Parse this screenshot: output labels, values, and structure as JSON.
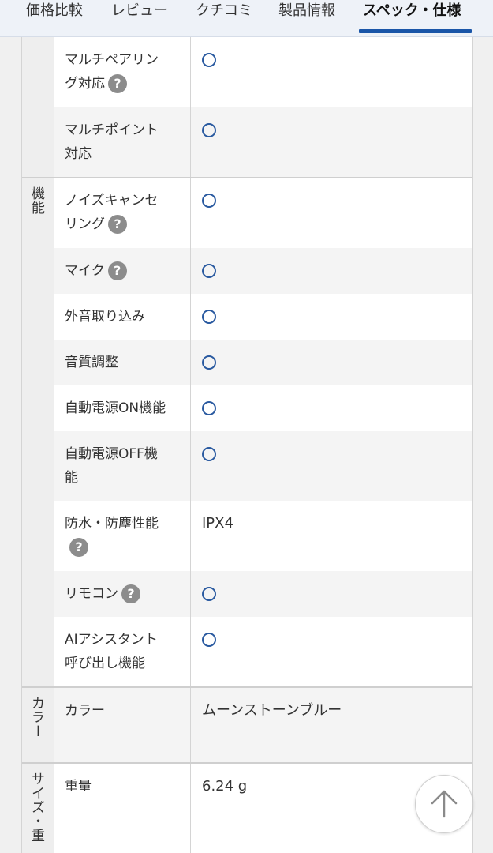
{
  "tabs": [
    {
      "label": "価格比較"
    },
    {
      "label": "レビュー"
    },
    {
      "label": "クチコミ"
    },
    {
      "label": "製品情報"
    },
    {
      "label": "スペック・仕様"
    }
  ],
  "sections": {
    "kinou": "機能",
    "color": "カラー",
    "size": "サイズ・重"
  },
  "rows": {
    "multipairing_1": "マルチペアリン",
    "multipairing_2": "グ対応",
    "multipoint_1": "マルチポイント",
    "multipoint_2": "対応",
    "nc_1": "ノイズキャンセ",
    "nc_2": "リング",
    "mic": "マイク",
    "ambient": "外音取り込み",
    "eq": "音質調整",
    "auto_on": "自動電源ON機能",
    "auto_off_1": "自動電源OFF機",
    "auto_off_2": "能",
    "waterproof": "防水・防塵性能",
    "waterproof_value": "IPX4",
    "remote": "リモコン",
    "ai_1": "AIアシスタント",
    "ai_2": "呼び出し機能",
    "color_label": "カラー",
    "color_value": "ムーンストーンブルー",
    "weight_label": "重量",
    "weight_value": "6.24 g"
  },
  "help_glyph": "?",
  "icons": {
    "supported": "circle-mark-icon",
    "help": "question-icon",
    "scroll_top": "arrow-up-icon"
  },
  "colors": {
    "accent": "#1a56a8",
    "circle": "#2a5aa0"
  }
}
